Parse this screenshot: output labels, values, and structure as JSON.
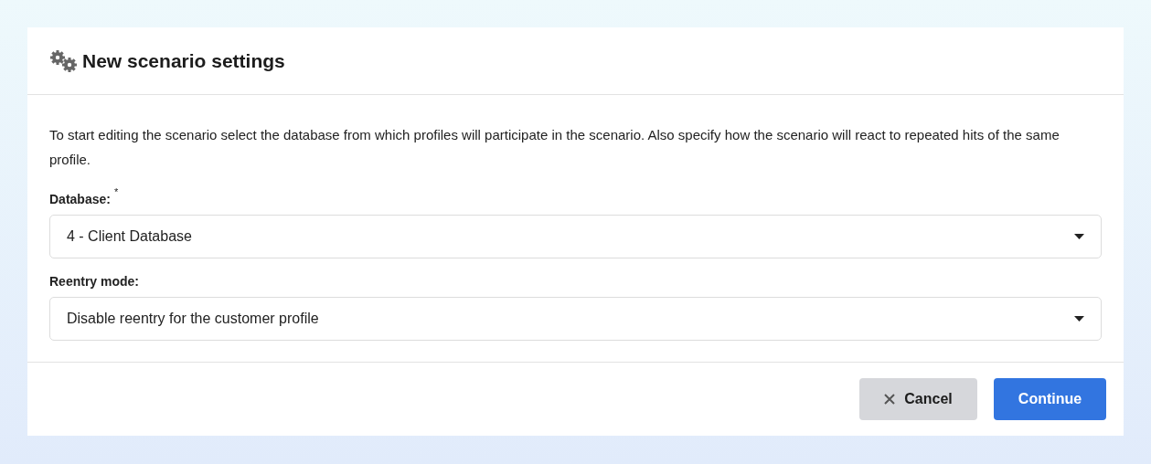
{
  "dialog": {
    "title": "New scenario settings",
    "description": "To start editing the scenario select the database from which profiles will participate in the scenario. Also specify how the scenario will react to repeated hits of the same profile.",
    "fields": [
      {
        "label": "Database:",
        "required_mark": "*",
        "value": "4 - Client Database"
      },
      {
        "label": "Reentry mode:",
        "value": "Disable reentry for the customer profile"
      }
    ],
    "buttons": [
      {
        "kind": "secondary",
        "label": "Cancel"
      },
      {
        "kind": "primary",
        "label": "Continue"
      }
    ]
  }
}
